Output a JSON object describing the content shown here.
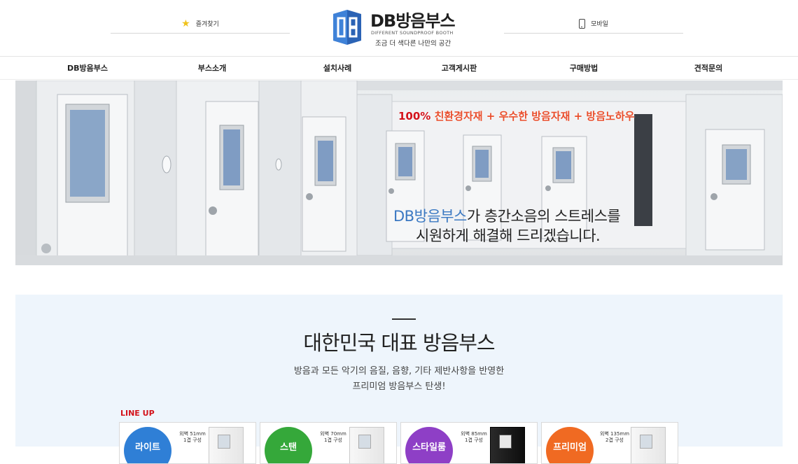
{
  "header": {
    "bookmark_label": "즐겨찾기",
    "mobile_label": "모바일",
    "logo_title": "DB방음부스",
    "logo_subtitle": "DIFFERENT SOUNDPROOF BOOTH",
    "logo_tagline": "조금 더 색다른 나만의 공간"
  },
  "nav": {
    "items": [
      "DB방음부스",
      "부스소개",
      "설치사례",
      "고객게시판",
      "구매방법",
      "견적문의"
    ]
  },
  "hero": {
    "tag_percent": "100%",
    "tag_text": "친환경자재 + 우수한 방음자재 + 방음노하우",
    "line1_brand": "DB방음부스",
    "line1_rest": "가 층간소음의 스트레스를",
    "line2": "시원하게 해결해 드리겠습니다."
  },
  "intro": {
    "title": "대한민국 대표 방음부스",
    "desc_line1": "방음과 모든 악기의 음질, 음향, 기타 제반사항을 반영한",
    "desc_line2": "프리미엄 방음부스 탄생!",
    "lineup_label": "LINE UP"
  },
  "lineup": [
    {
      "name": "라이트",
      "spec1": "외벽 51mm",
      "spec2": "1겹 구성",
      "color": "#2f7fd6",
      "booth": "light"
    },
    {
      "name": "스탠",
      "spec1": "외벽 70mm",
      "spec2": "1겹 구성",
      "color": "#35a83a",
      "booth": "light"
    },
    {
      "name": "스타일룸",
      "spec1": "외벽 85mm",
      "spec2": "1겹 구성",
      "color": "#8e3fc6",
      "booth": "dark"
    },
    {
      "name": "프리미엄",
      "spec1": "외벽 135mm",
      "spec2": "2겹 구성",
      "color": "#f06a22",
      "booth": "light"
    }
  ],
  "colors": {
    "accent_red": "#d3121a",
    "accent_orange": "#e94e2c",
    "brand_blue": "#3a78c2",
    "intro_bg": "#eef5fc"
  }
}
